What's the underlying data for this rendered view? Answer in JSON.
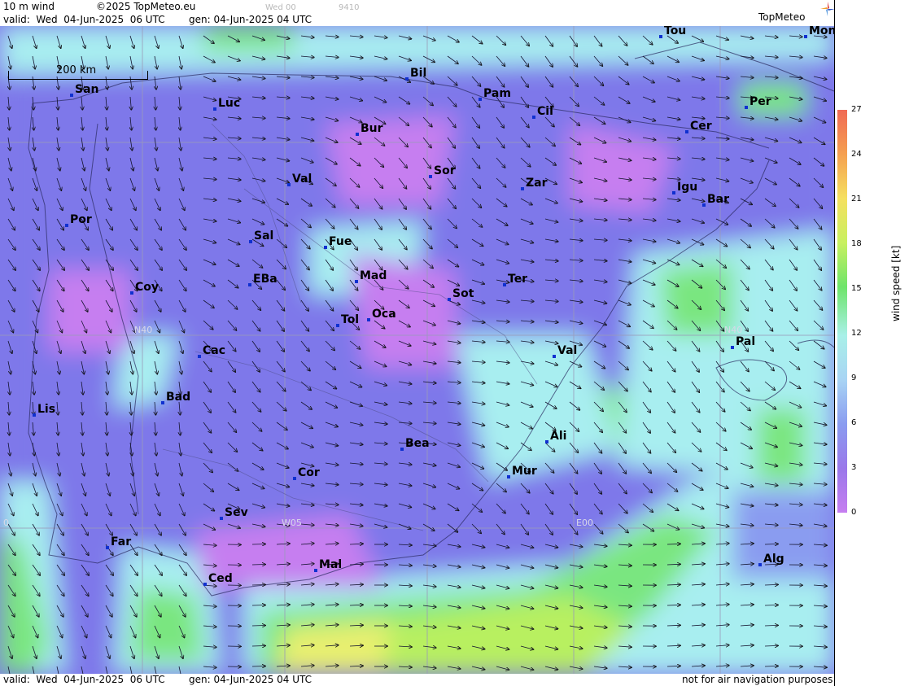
{
  "header": {
    "title": "10 m wind",
    "copyright": "©2025 TopMeteo.eu",
    "frame": "Wed 00",
    "code": "9410",
    "valid": "valid:  Wed  04-Jun-2025  06 UTC",
    "gen": "gen: 04-Jun-2025 04 UTC",
    "brand": "TopMeteo"
  },
  "footer": {
    "valid": "valid:  Wed  04-Jun-2025  06 UTC",
    "gen": "gen: 04-Jun-2025 04 UTC",
    "disclaimer": "not for air navigation purposes"
  },
  "scale_label": "200 km",
  "grid_labels": {
    "lat": "N40",
    "lat2": "N40",
    "lon1": "W05",
    "lon2": "E00",
    "lon0": "0"
  },
  "legend": {
    "label": "wind speed [kt]",
    "ticks": [
      "27",
      "24",
      "21",
      "18",
      "15",
      "12",
      "9",
      "6",
      "3",
      "0"
    ],
    "colors": [
      "#f06a55",
      "#f5a050",
      "#f5e060",
      "#c8f060",
      "#6ee46a",
      "#a8f0e8",
      "#a8d4f4",
      "#8a9cf0",
      "#9a78ea",
      "#c67ef0"
    ]
  },
  "cities": [
    "Tou",
    "Mon",
    "Bil",
    "San",
    "Pam",
    "Luc",
    "Cil",
    "Per",
    "Bur",
    "Cer",
    "Sor",
    "Val",
    "Zar",
    "Igu",
    "Bar",
    "Por",
    "Sal",
    "Fue",
    "Mad",
    "Ter",
    "EBa",
    "Coy",
    "Sot",
    "Tol",
    "Oca",
    "Pal",
    "Cac",
    "Val",
    "Bad",
    "Lis",
    "Ali",
    "Bea",
    "Mur",
    "Cor",
    "Sev",
    "Far",
    "Mal",
    "Alg",
    "Ced"
  ]
}
